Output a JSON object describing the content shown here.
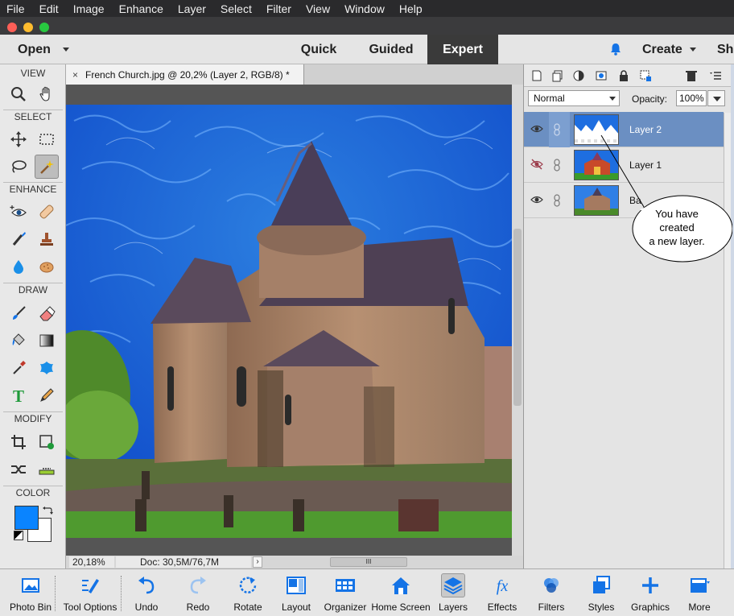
{
  "menu": [
    "File",
    "Edit",
    "Image",
    "Enhance",
    "Layer",
    "Select",
    "Filter",
    "View",
    "Window",
    "Help"
  ],
  "header": {
    "open_label": "Open",
    "modes": [
      "Quick",
      "Guided",
      "Expert"
    ],
    "active_mode": "Expert",
    "create_label": "Create",
    "share_label": "Sh"
  },
  "toolbox": {
    "sections": [
      "VIEW",
      "SELECT",
      "ENHANCE",
      "DRAW",
      "MODIFY",
      "COLOR"
    ],
    "foreground_color": "#0a84ff",
    "background_color": "#ffffff"
  },
  "document": {
    "tab_title": "French Church.jpg @ 20,2% (Layer 2, RGB/8) *",
    "close_glyph": "×"
  },
  "status": {
    "zoom": "20,18%",
    "doc_size": "Doc: 30,5M/76,7M"
  },
  "layers_panel": {
    "blend_mode": "Normal",
    "opacity_label": "Opacity:",
    "opacity_value": "100%",
    "layers": [
      {
        "name": "Layer 2",
        "visible": true,
        "active": true
      },
      {
        "name": "Layer 1",
        "visible": false,
        "active": false
      },
      {
        "name": "Ba",
        "visible": true,
        "active": false
      }
    ]
  },
  "callout": {
    "line1": "You have",
    "line2": "created",
    "line3": "a new layer."
  },
  "taskbar": [
    {
      "label": "Photo Bin",
      "icon": "photo-bin-icon"
    },
    {
      "label": "Tool Options",
      "icon": "tool-options-icon"
    },
    {
      "label": "Undo",
      "icon": "undo-icon"
    },
    {
      "label": "Redo",
      "icon": "redo-icon"
    },
    {
      "label": "Rotate",
      "icon": "rotate-icon"
    },
    {
      "label": "Layout",
      "icon": "layout-icon"
    },
    {
      "label": "Organizer",
      "icon": "organizer-icon"
    },
    {
      "label": "Home Screen",
      "icon": "home-icon"
    },
    {
      "label": "Layers",
      "icon": "layers-icon"
    },
    {
      "label": "Effects",
      "icon": "fx-icon"
    },
    {
      "label": "Filters",
      "icon": "filters-icon"
    },
    {
      "label": "Styles",
      "icon": "styles-icon"
    },
    {
      "label": "Graphics",
      "icon": "graphics-icon"
    },
    {
      "label": "More",
      "icon": "more-icon"
    }
  ],
  "colors": {
    "accent_blue": "#0a84ff",
    "active_layer": "#6b8fc2",
    "expert_tab": "#3a3a3a"
  }
}
